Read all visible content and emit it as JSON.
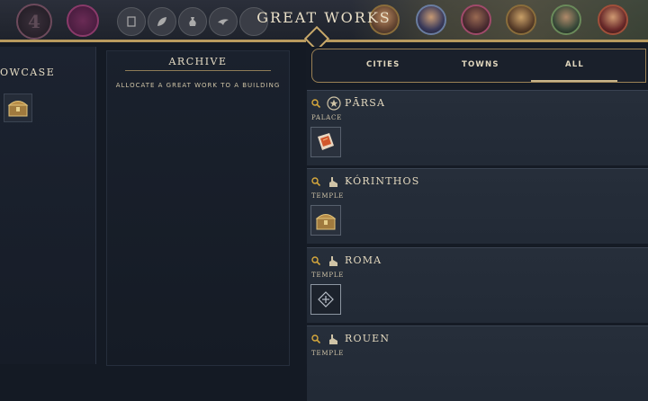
{
  "header": {
    "era_number": "4",
    "title": "GREAT WORKS"
  },
  "showcase": {
    "title": "OWCASE"
  },
  "archive": {
    "title": "ARCHIVE",
    "subtitle": "ALLOCATE A GREAT WORK TO A BUILDING"
  },
  "tabs": [
    {
      "label": "CITIES",
      "selected": false
    },
    {
      "label": "TOWNS",
      "selected": false
    },
    {
      "label": "ALL",
      "selected": true
    }
  ],
  "settlements": [
    {
      "name": "PĀRSA",
      "building": "PALACE",
      "building_icon": "star-icon",
      "work": "manuscript-work-icon"
    },
    {
      "name": "KÓRINTHOS",
      "building": "TEMPLE",
      "building_icon": "temple-icon",
      "work": "treasure-chest-work-icon"
    },
    {
      "name": "ROMA",
      "building": "TEMPLE",
      "building_icon": "temple-icon",
      "work": "empty-slot-icon"
    },
    {
      "name": "ROUEN",
      "building": "TEMPLE",
      "building_icon": "temple-icon",
      "work": ""
    }
  ],
  "colors": {
    "gold": "#c9a96a",
    "bg": "#151b25",
    "zoom": "#d8a93c"
  }
}
